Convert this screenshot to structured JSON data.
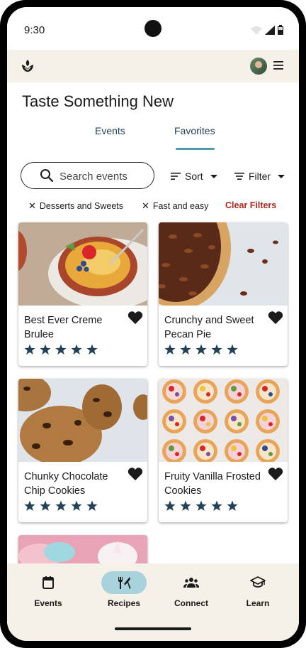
{
  "status": {
    "time": "9:30"
  },
  "page": {
    "title": "Taste Something New"
  },
  "tabs": [
    {
      "label": "Events",
      "active": false
    },
    {
      "label": "Favorites",
      "active": true
    }
  ],
  "search": {
    "placeholder": "Search events"
  },
  "controls": {
    "sort_label": "Sort",
    "filter_label": "Filter"
  },
  "filters": {
    "chips": [
      "Desserts and Sweets",
      "Fast and easy"
    ],
    "clear_label": "Clear Filters"
  },
  "cards": [
    {
      "title": "Best Ever Creme Brulee",
      "favorite": true,
      "rating": 5
    },
    {
      "title": "Crunchy and Sweet Pecan Pie",
      "favorite": true,
      "rating": 5
    },
    {
      "title": "Chunky Chocolate Chip Cookies",
      "favorite": true,
      "rating": 5
    },
    {
      "title": "Fruity Vanilla Frosted Cookies",
      "favorite": true,
      "rating": 5
    }
  ],
  "nav": [
    {
      "label": "Events",
      "icon": "calendar-icon",
      "active": false
    },
    {
      "label": "Recipes",
      "icon": "utensils-icon",
      "active": true
    },
    {
      "label": "Connect",
      "icon": "people-icon",
      "active": false
    },
    {
      "label": "Learn",
      "icon": "graduation-cap-icon",
      "active": false
    }
  ],
  "colors": {
    "accent": "#4d9aa8",
    "nav_active": "#a8d3dd",
    "surface": "#f5f1e8",
    "star": "#234155",
    "clear": "#b3261e"
  }
}
